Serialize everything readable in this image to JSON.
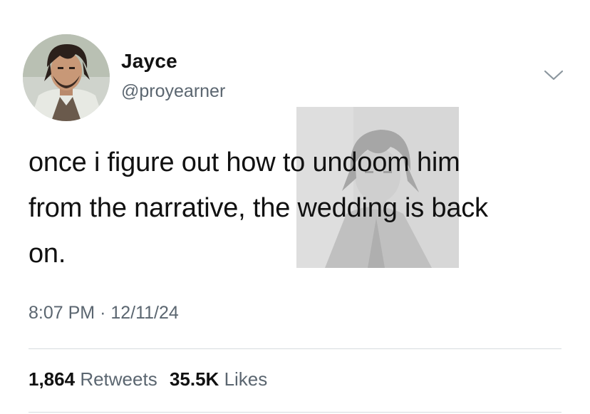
{
  "author": {
    "display_name": "Jayce",
    "handle": "@proyearner"
  },
  "tweet": {
    "text_line1": "once i figure out how to undoom him",
    "text_line2": "from the narrative, the wedding is back",
    "text_line3": "on.",
    "time": "8:07 PM",
    "separator": "·",
    "date": "12/11/24"
  },
  "stats": {
    "retweets_count": "1,864",
    "retweets_label": "Retweets",
    "likes_count": "35.5K",
    "likes_label": "Likes"
  },
  "icons": {
    "menu": "chevron-down-icon"
  },
  "colors": {
    "text": "#111111",
    "secondary": "#5b6670",
    "divider": "#d6dbdf",
    "background": "#ffffff"
  }
}
